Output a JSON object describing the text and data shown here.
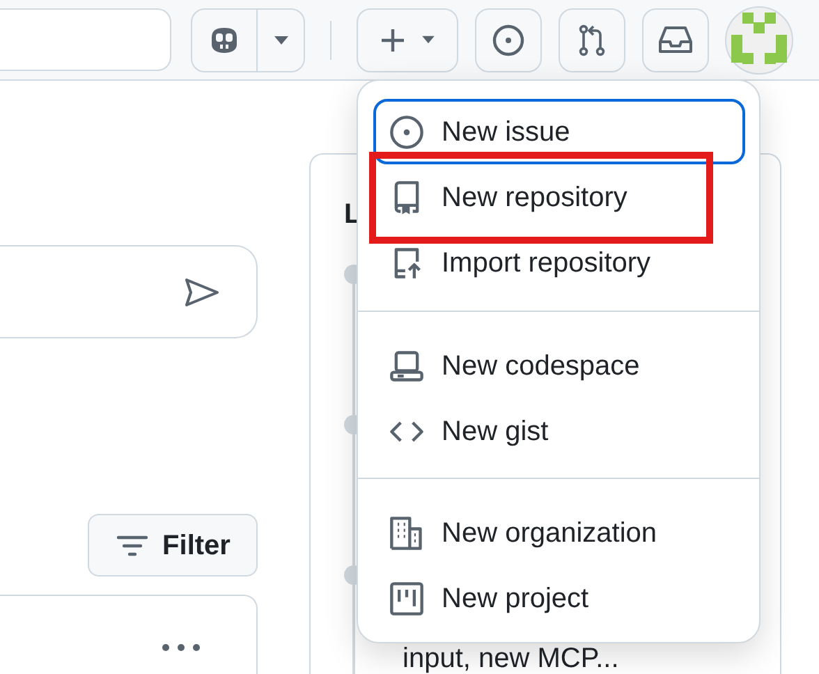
{
  "filter_button": {
    "label": "Filter"
  },
  "activity_card": {
    "heading": "L",
    "snippet": "input, new MCP..."
  },
  "new_menu": {
    "groups": [
      [
        {
          "kind": "issue",
          "label": "New issue",
          "focused": true,
          "highlighted": false
        },
        {
          "kind": "repository",
          "label": "New repository",
          "focused": false,
          "highlighted": true
        },
        {
          "kind": "import",
          "label": "Import repository",
          "focused": false,
          "highlighted": false
        }
      ],
      [
        {
          "kind": "codespace",
          "label": "New codespace",
          "focused": false,
          "highlighted": false
        },
        {
          "kind": "gist",
          "label": "New gist",
          "focused": false,
          "highlighted": false
        }
      ],
      [
        {
          "kind": "organization",
          "label": "New organization",
          "focused": false,
          "highlighted": false
        },
        {
          "kind": "project",
          "label": "New project",
          "focused": false,
          "highlighted": false
        }
      ]
    ]
  }
}
